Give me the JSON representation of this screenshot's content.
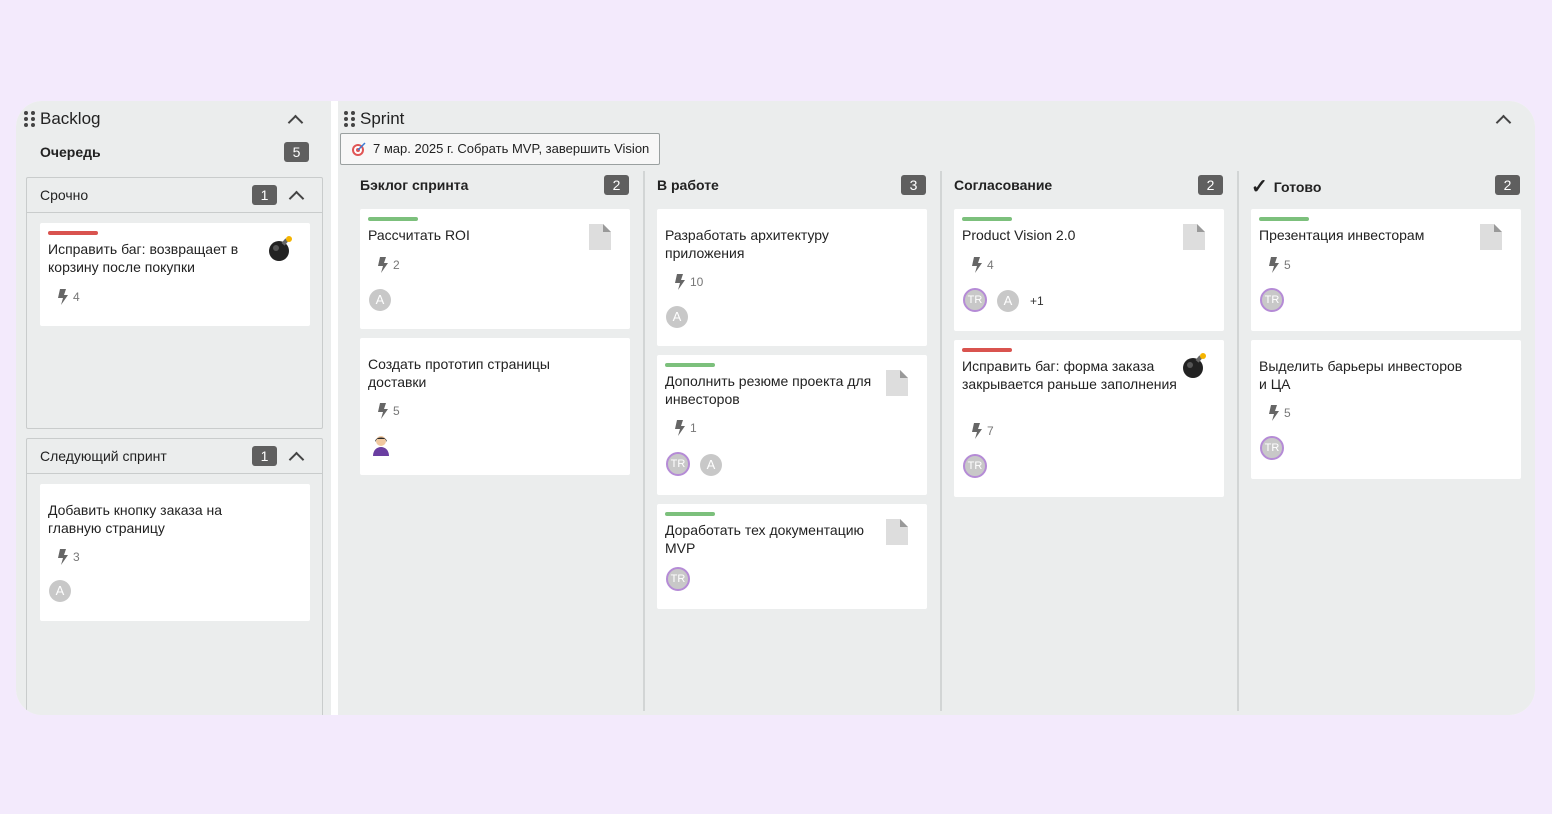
{
  "backlog": {
    "title": "Backlog",
    "queue_label": "Очередь",
    "queue_count": "5",
    "groups": [
      {
        "title": "Срочно",
        "count": "1",
        "cards": [
          {
            "title": "Исправить баг: возвращает в корзину после покупки",
            "points": "4",
            "stripe": "#d9534f",
            "icon": "bomb-icon"
          }
        ]
      },
      {
        "title": "Следующий спринт",
        "count": "1",
        "cards": [
          {
            "title": "Добавить кнопку заказа на главную страницу",
            "points": "3",
            "avatar": "A"
          }
        ]
      }
    ]
  },
  "sprint": {
    "title": "Sprint",
    "goal": "7 мар. 2025 г. Собрать MVP, завершить Vision",
    "columns": [
      {
        "title": "Бэклог спринта",
        "count": "2",
        "cards": [
          {
            "title": "Рассчитать ROI",
            "points": "2",
            "avatar": "A",
            "stripe": "#7cc07c",
            "icon": "document-icon"
          },
          {
            "title": "Создать прототип страницы доставки",
            "points": "5",
            "avatar": "user-photo"
          }
        ]
      },
      {
        "title": "В работе",
        "count": "3",
        "cards": [
          {
            "title": "Разработать архитектуру приложения",
            "points": "10",
            "avatar": "A"
          },
          {
            "title": "Дополнить резюме проекта для инвесторов",
            "points": "1",
            "avatars": [
              "TR",
              "A"
            ],
            "stripe": "#7cc07c",
            "icon": "document-icon"
          },
          {
            "title": "Доработать тех документацию MVP",
            "avatar": "TR",
            "stripe": "#7cc07c",
            "icon": "document-icon"
          }
        ]
      },
      {
        "title": "Согласование",
        "count": "2",
        "cards": [
          {
            "title": "Product Vision 2.0",
            "points": "4",
            "avatars": [
              "TR",
              "A"
            ],
            "extra": "+1",
            "stripe": "#7cc07c",
            "icon": "document-icon"
          },
          {
            "title": "Исправить баг: форма заказа закрывается раньше заполнения",
            "points": "7",
            "avatar": "TR",
            "stripe": "#d9534f",
            "icon": "bomb-icon"
          }
        ]
      },
      {
        "title": "Готово",
        "count": "2",
        "done_mark": "✓",
        "cards": [
          {
            "title": "Презентация инвесторам",
            "points": "5",
            "avatar": "TR",
            "stripe": "#7cc07c",
            "icon": "document-icon"
          },
          {
            "title": "Выделить барьеры инвесторов и ЦА",
            "points": "5",
            "avatar": "TR"
          }
        ]
      }
    ]
  },
  "colors": {
    "background": "#f3eafc",
    "panel": "#ebeded",
    "badge": "#5f5f5f",
    "green_stripe": "#7cc07c",
    "red_stripe": "#d9534f",
    "avatar_ring": "#b58bd6"
  }
}
